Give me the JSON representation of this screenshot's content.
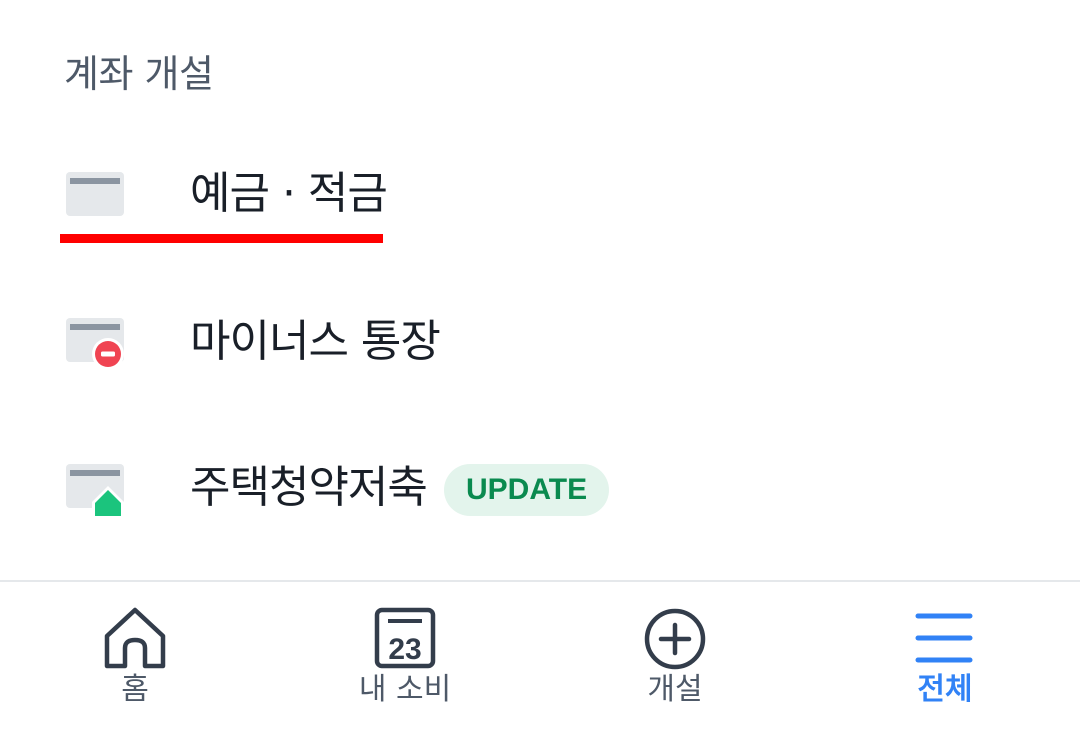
{
  "section": {
    "title": "계좌 개설"
  },
  "menu": {
    "items": [
      {
        "label": "예금 · 적금",
        "icon": "card-icon"
      },
      {
        "label": "마이너스 통장",
        "icon": "card-minus-icon"
      },
      {
        "label": "주택청약저축",
        "icon": "card-house-icon",
        "badge": "UPDATE"
      }
    ]
  },
  "colors": {
    "highlight_underline": "#ff0000",
    "badge_bg": "#e3f4ec",
    "badge_text": "#0a8a4f",
    "minus_badge": "#f04452",
    "house_badge": "#1bc47d",
    "active_tab": "#3182f6"
  },
  "tabbar": {
    "tabs": [
      {
        "label": "홈",
        "icon": "home-icon",
        "active": false
      },
      {
        "label": "내 소비",
        "icon": "calendar-icon",
        "icon_text": "23",
        "active": false
      },
      {
        "label": "개설",
        "icon": "plus-circle-icon",
        "active": false
      },
      {
        "label": "전체",
        "icon": "menu-icon",
        "active": true
      }
    ]
  }
}
